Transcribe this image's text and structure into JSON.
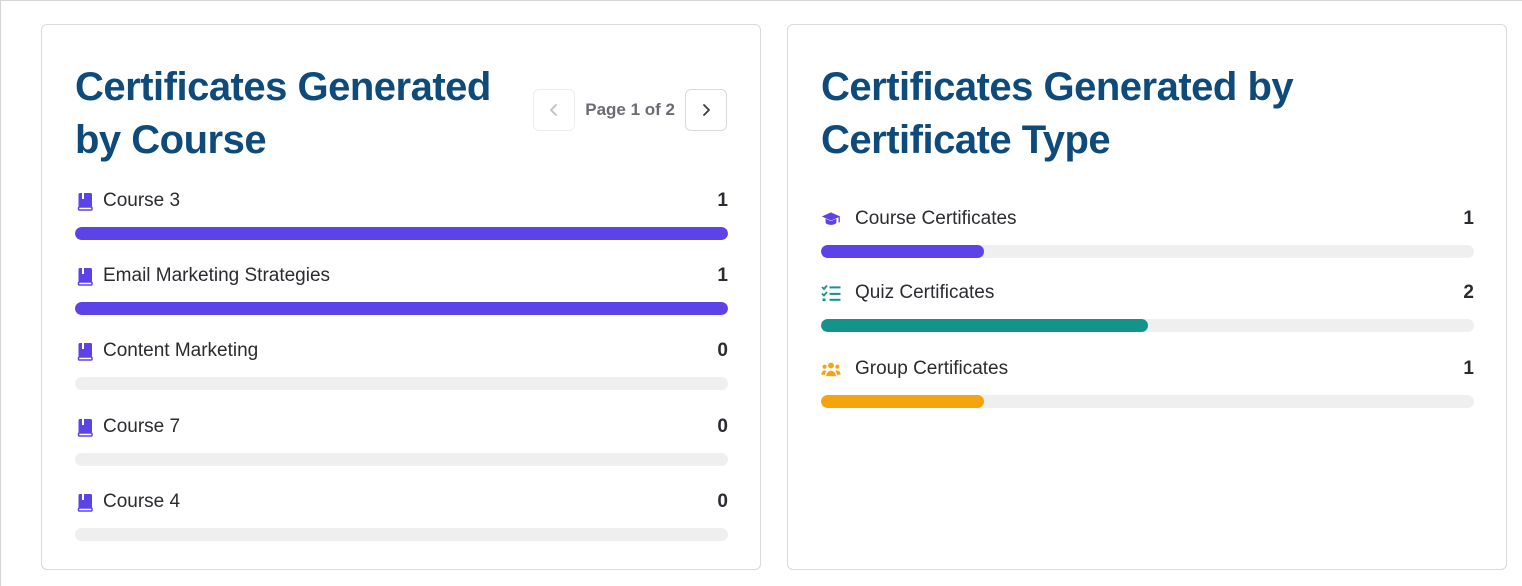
{
  "course_card": {
    "title": "Certificates Generated by Course",
    "pagination": {
      "text": "Page 1 of 2",
      "current": 1,
      "total": 2
    },
    "items": [
      {
        "label": "Course 3",
        "count": "1",
        "fraction": 1.0,
        "icon": "book-icon",
        "color": "#5b43e8"
      },
      {
        "label": "Email Marketing Strategies",
        "count": "1",
        "fraction": 1.0,
        "icon": "book-icon",
        "color": "#5b43e8"
      },
      {
        "label": "Content Marketing",
        "count": "0",
        "fraction": 0.0,
        "icon": "book-icon",
        "color": "#5b43e8"
      },
      {
        "label": "Course 7",
        "count": "0",
        "fraction": 0.0,
        "icon": "book-icon",
        "color": "#5b43e8"
      },
      {
        "label": "Course 4",
        "count": "0",
        "fraction": 0.0,
        "icon": "book-icon",
        "color": "#5b43e8"
      }
    ]
  },
  "type_card": {
    "title": "Certificates Generated by Certificate Type",
    "items": [
      {
        "label": "Course Certificates",
        "count": "1",
        "fraction": 0.25,
        "icon": "graduation-cap-icon",
        "color": "#5b43e8"
      },
      {
        "label": "Quiz Certificates",
        "count": "2",
        "fraction": 0.5,
        "icon": "checklist-icon",
        "color": "#13948a"
      },
      {
        "label": "Group Certificates",
        "count": "1",
        "fraction": 0.25,
        "icon": "group-icon",
        "color": "#f5a30f"
      }
    ]
  }
}
